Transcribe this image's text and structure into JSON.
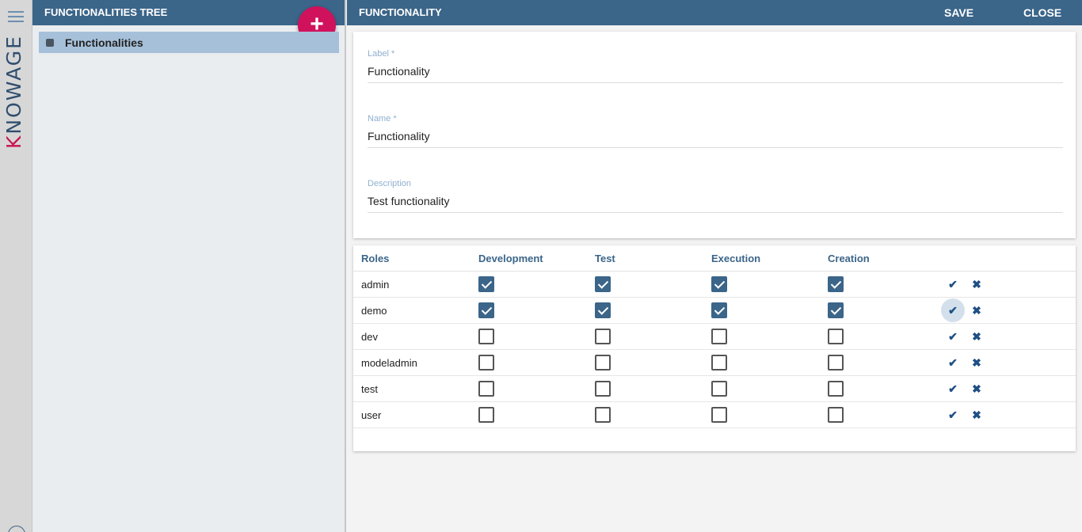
{
  "brand": {
    "logo_text": "KNOWAGE"
  },
  "tree": {
    "header": "FUNCTIONALITIES TREE",
    "add_label": "+",
    "items": [
      {
        "label": "Functionalities"
      }
    ]
  },
  "detail": {
    "header": "FUNCTIONALITY",
    "save_label": "SAVE",
    "close_label": "CLOSE",
    "fields": {
      "label": {
        "label": "Label *",
        "value": "Functionality"
      },
      "name": {
        "label": "Name *",
        "value": "Functionality"
      },
      "description": {
        "label": "Description",
        "value": "Test functionality"
      }
    }
  },
  "roles_table": {
    "columns": [
      "Roles",
      "Development",
      "Test",
      "Execution",
      "Creation"
    ],
    "rows": [
      {
        "role": "admin",
        "development": true,
        "test": true,
        "execution": true,
        "creation": true
      },
      {
        "role": "demo",
        "development": true,
        "test": true,
        "execution": true,
        "creation": true
      },
      {
        "role": "dev",
        "development": false,
        "test": false,
        "execution": false,
        "creation": false
      },
      {
        "role": "modeladmin",
        "development": false,
        "test": false,
        "execution": false,
        "creation": false
      },
      {
        "role": "test",
        "development": false,
        "test": false,
        "execution": false,
        "creation": false
      },
      {
        "role": "user",
        "development": false,
        "test": false,
        "execution": false,
        "creation": false
      }
    ],
    "row_actions": {
      "check_all_icon": "check-icon",
      "uncheck_all_icon": "close-icon",
      "check_glyph": "✔",
      "clear_glyph": "✖"
    }
  },
  "colors": {
    "header": "#3b6589",
    "fab": "#d0115c",
    "selection": "#a6c0d9",
    "label": "#8fb0cf"
  }
}
